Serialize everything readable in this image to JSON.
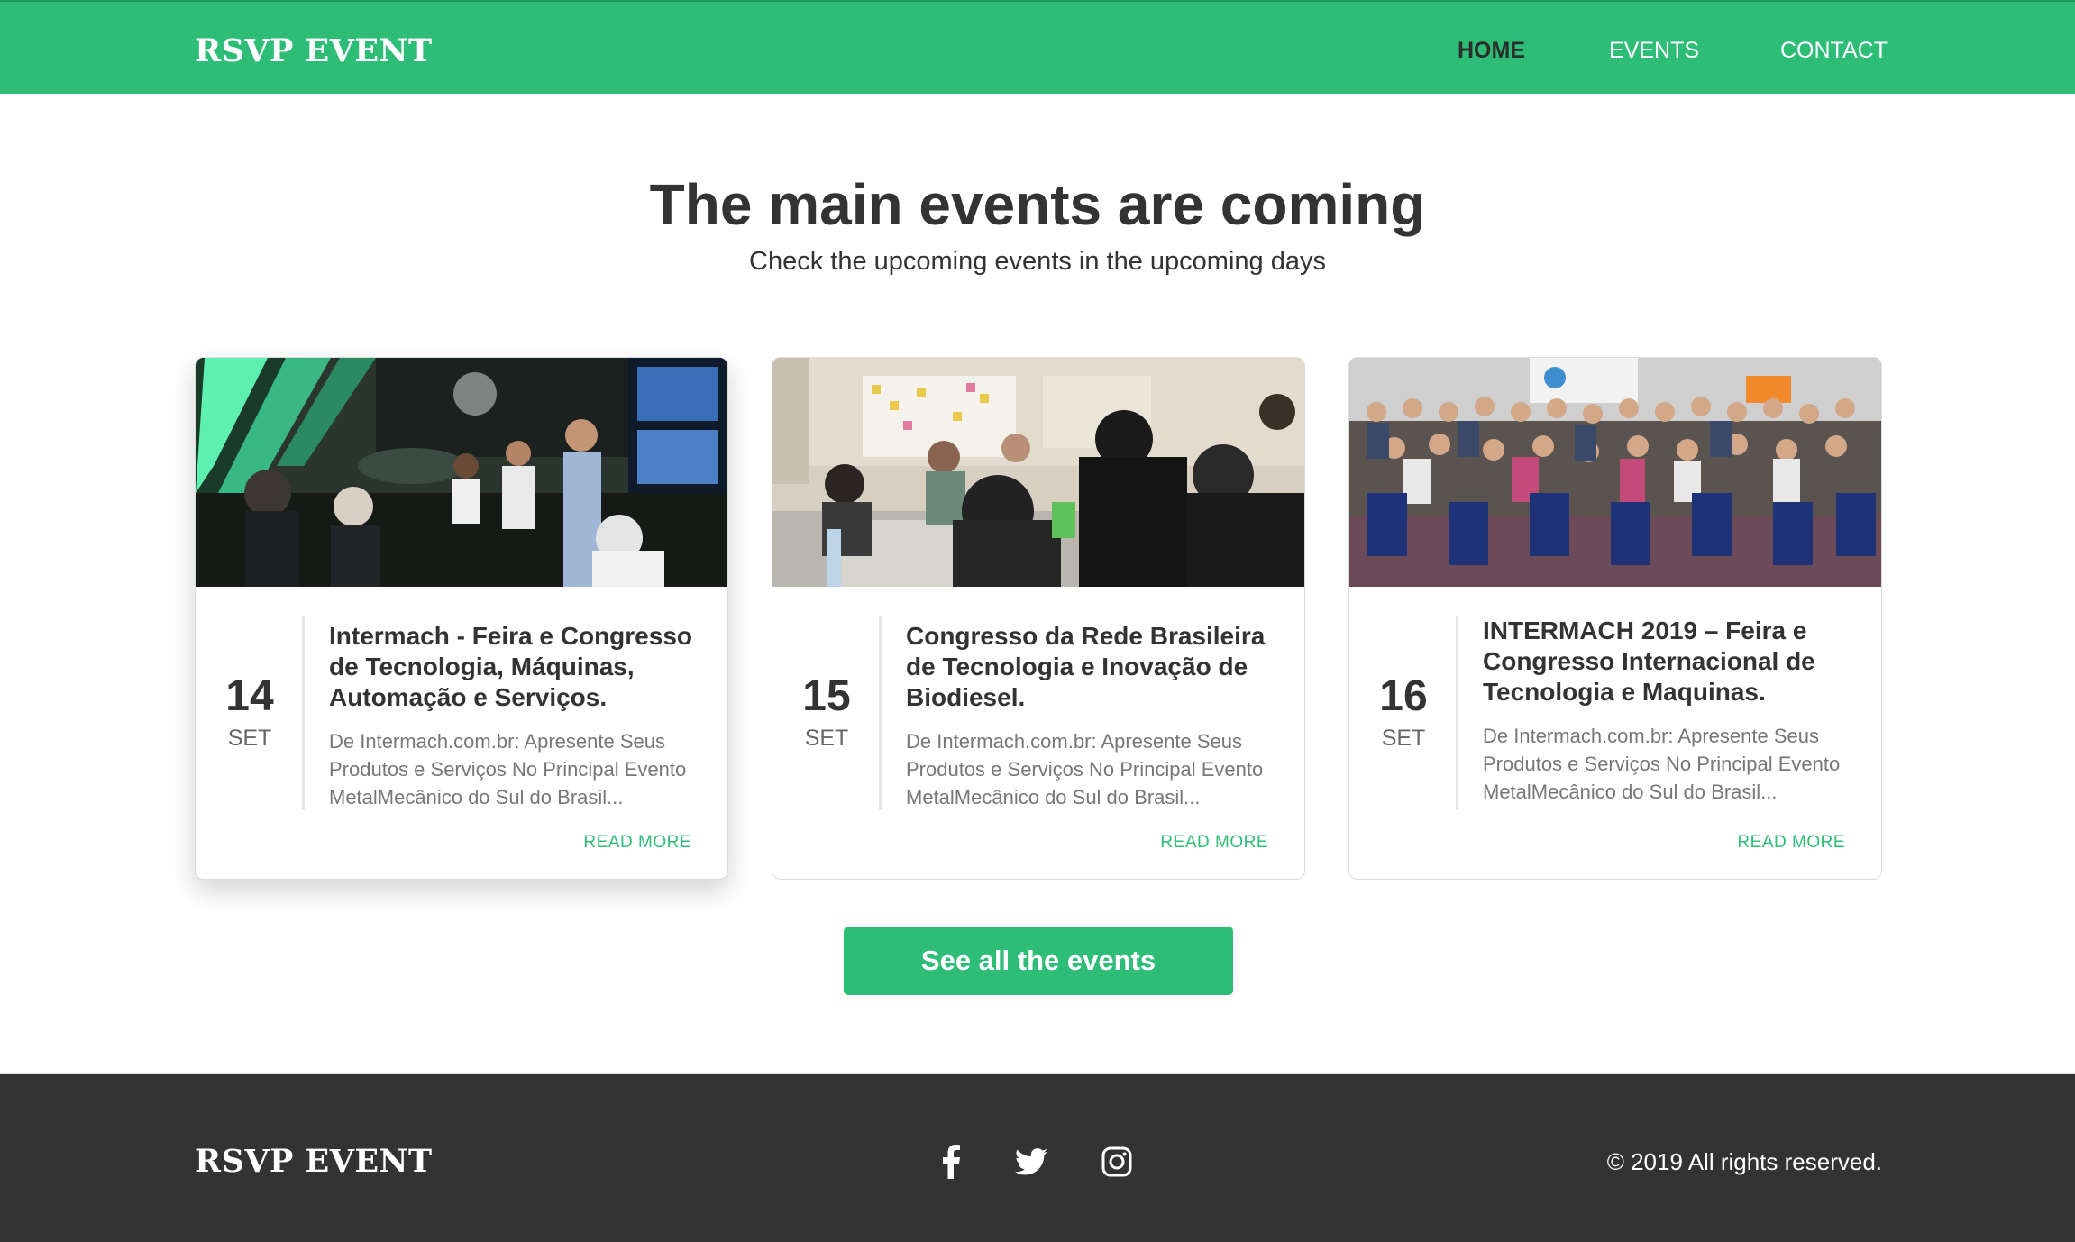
{
  "header": {
    "brand": "RSVP EVENT",
    "nav": [
      {
        "label": "HOME",
        "active": true
      },
      {
        "label": "EVENTS",
        "active": false
      },
      {
        "label": "CONTACT",
        "active": false
      }
    ]
  },
  "hero": {
    "title": "The main events are coming",
    "subtitle": "Check the upcoming events in the upcoming days"
  },
  "events": [
    {
      "day": "14",
      "month": "SET",
      "title": "Intermach - Feira e Congresso de Tecnologia, Máquinas, Automação e Serviços.",
      "description": "De Intermach.com.br: Apresente Seus Produtos e Serviços No Principal Evento MetalMecânico do Sul do Brasil...",
      "read_more": "READ MORE",
      "image": "conference-room-photo"
    },
    {
      "day": "15",
      "month": "SET",
      "title": "Congresso da Rede Brasileira de Tecnologia e Inovação de Biodiesel.",
      "description": "De Intermach.com.br: Apresente Seus Produtos e Serviços No Principal Evento MetalMecânico do Sul do Brasil...",
      "read_more": "READ MORE",
      "image": "classroom-photo"
    },
    {
      "day": "16",
      "month": "SET",
      "title": "INTERMACH 2019 – Feira e Congresso Internacional de Tecnologia e Maquinas.",
      "description": "De Intermach.com.br: Apresente Seus Produtos e Serviços No Principal Evento MetalMecânico do Sul do Brasil...",
      "read_more": "READ MORE",
      "image": "group-photo"
    }
  ],
  "cta": {
    "label": "See all the events"
  },
  "footer": {
    "brand": "RSVP EVENT",
    "social": [
      "facebook-icon",
      "twitter-icon",
      "instagram-icon"
    ],
    "copyright": "© 2019 All rights reserved."
  },
  "colors": {
    "accent": "#2ebd77",
    "footer_bg": "#333333",
    "text_dark": "#333333",
    "text_muted": "#777777"
  }
}
